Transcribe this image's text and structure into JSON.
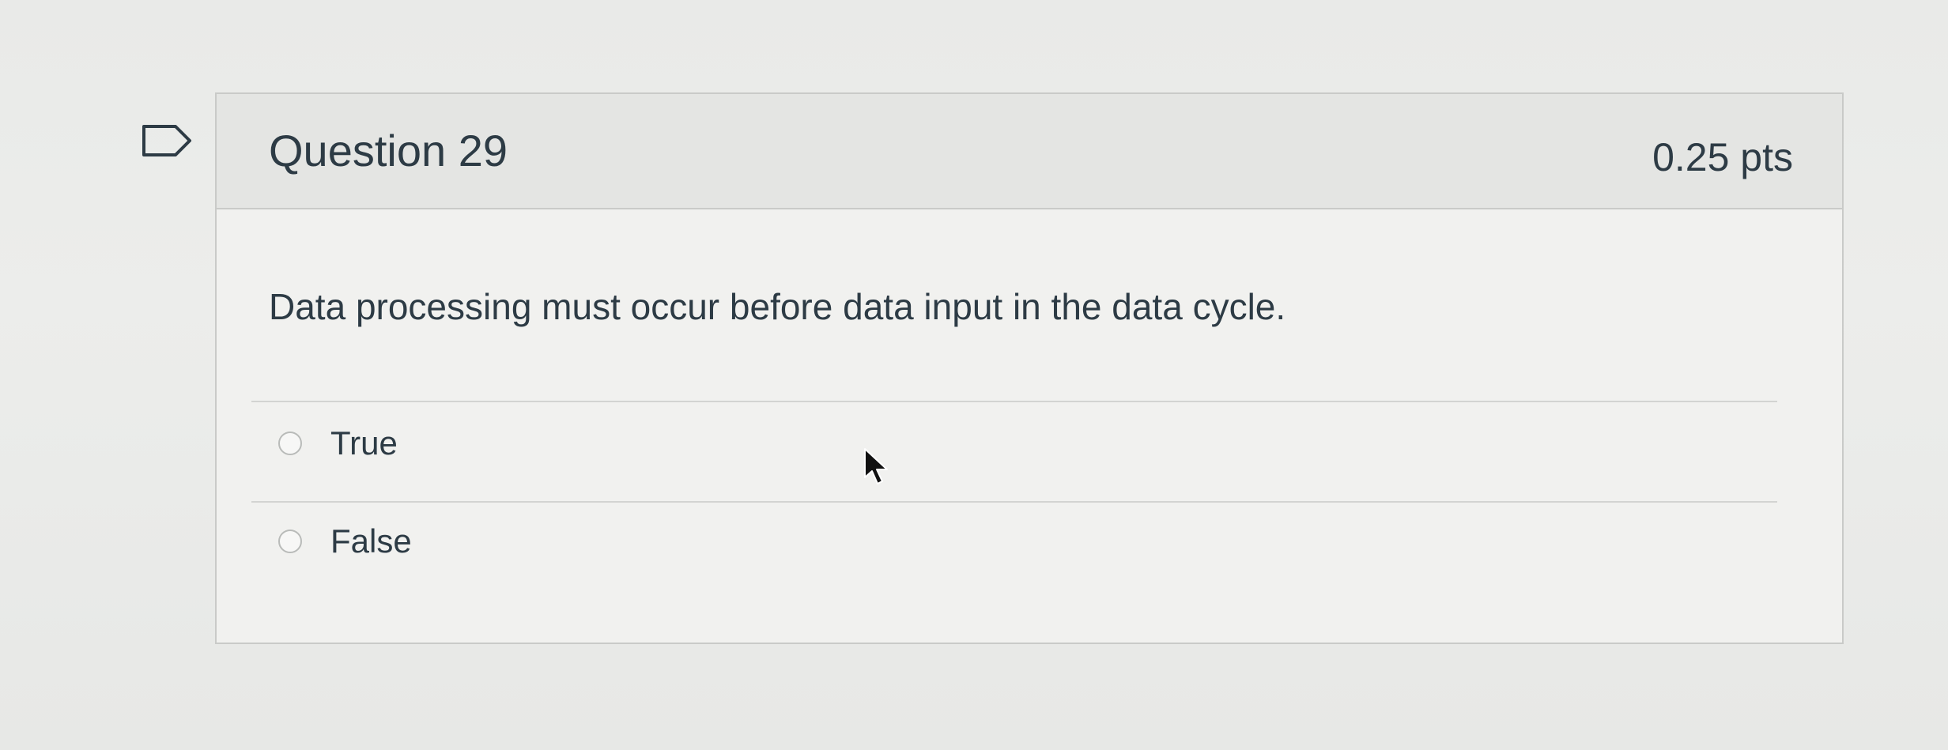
{
  "question": {
    "title": "Question 29",
    "points": "0.25 pts",
    "text": "Data processing must occur before data input in the data cycle.",
    "flag_icon": "bookmark-flag-icon",
    "answers": [
      {
        "label": "True",
        "selected": false
      },
      {
        "label": "False",
        "selected": false
      }
    ]
  },
  "colors": {
    "text": "#2d3b45",
    "header_bg": "#e4e5e3",
    "border": "#c9cac8"
  }
}
